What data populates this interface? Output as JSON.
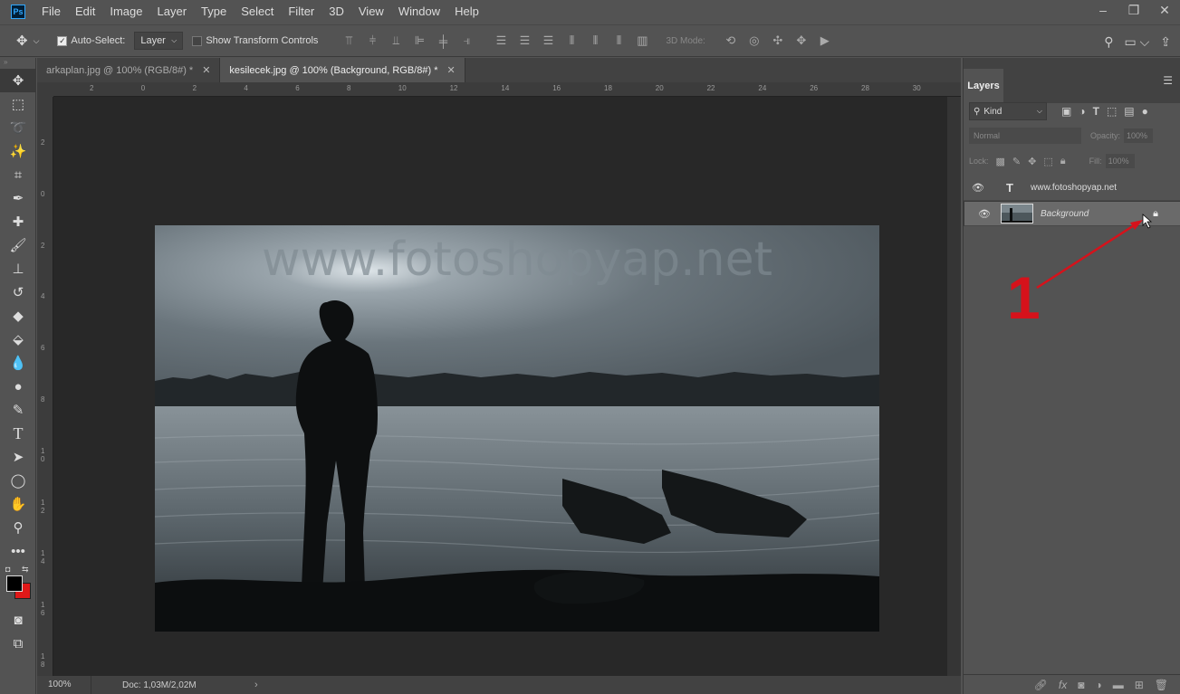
{
  "app": {
    "logo": "Ps"
  },
  "menu": [
    "File",
    "Edit",
    "Image",
    "Layer",
    "Type",
    "Select",
    "Filter",
    "3D",
    "View",
    "Window",
    "Help"
  ],
  "window_controls": [
    "–",
    "❐",
    "✕"
  ],
  "options": {
    "auto_select_label": "Auto-Select:",
    "auto_select_value": "Layer",
    "transform_label": "Show Transform Controls",
    "mode_3d_label": "3D Mode:"
  },
  "tabs": [
    {
      "label": "arkaplan.jpg @ 100% (RGB/8#) *",
      "active": false
    },
    {
      "label": "kesilecek.jpg @ 100% (Background, RGB/8#) *",
      "active": true
    }
  ],
  "ruler_h": [
    "2",
    "0",
    "2",
    "4",
    "6",
    "8",
    "10",
    "12",
    "14",
    "16",
    "18",
    "20",
    "22",
    "24",
    "26",
    "28",
    "30"
  ],
  "ruler_v": [
    "2",
    "0",
    "2",
    "4",
    "6",
    "8",
    "1\n0",
    "1\n2",
    "1\n4",
    "1\n6",
    "1\n8"
  ],
  "photo": {
    "watermark": "www.fotoshopyap.net"
  },
  "status": {
    "zoom": "100%",
    "doc": "Doc: 1,03M/2,02M"
  },
  "layers_panel": {
    "tab_label": "Layers",
    "kind_label": "Kind",
    "blend_mode": "Normal",
    "opacity_label": "Opacity:",
    "opacity_value": "100%",
    "lock_label": "Lock:",
    "fill_label": "Fill:",
    "fill_value": "100%",
    "layers": [
      {
        "name": "www.fotoshopyap.net",
        "type": "text",
        "selected": false
      },
      {
        "name": "Background",
        "type": "image",
        "selected": true
      }
    ]
  },
  "annotation": {
    "number": "1",
    "color": "#d6121b"
  }
}
